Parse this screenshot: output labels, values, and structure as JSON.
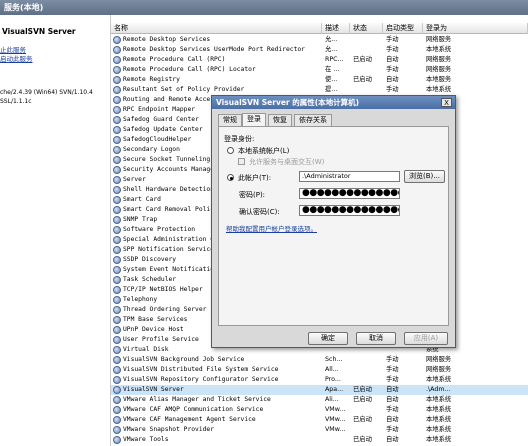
{
  "window": {
    "title": "服务(本地)"
  },
  "left_pane": {
    "service_title": "VisualSVN Server",
    "links": [
      "止此服务",
      "启动此服务"
    ],
    "desc_lines": [
      "che/2.4.39 (Win64) SVN/1.10.4",
      "SSL/1.1.1c"
    ]
  },
  "table": {
    "columns": [
      "名称",
      "描述",
      "状态",
      "启动类型",
      "登录为"
    ],
    "rows": [
      {
        "name": "Remote Desktop Services",
        "desc": "允...",
        "status": "",
        "startup": "手动",
        "logon": "网络服务"
      },
      {
        "name": "Remote Desktop Services UserMode Port Redirector",
        "desc": "允...",
        "status": "",
        "startup": "手动",
        "logon": "本地系统"
      },
      {
        "name": "Remote Procedure Call (RPC)",
        "desc": "RPC...",
        "status": "已启动",
        "startup": "自动",
        "logon": "网络服务"
      },
      {
        "name": "Remote Procedure Call (RPC) Locator",
        "desc": "在 ...",
        "status": "",
        "startup": "手动",
        "logon": "网络服务"
      },
      {
        "name": "Remote Registry",
        "desc": "使...",
        "status": "已启动",
        "startup": "自动",
        "logon": "本地服务"
      },
      {
        "name": "Resultant Set of Policy Provider",
        "desc": "提...",
        "status": "",
        "startup": "手动",
        "logon": "本地系统"
      },
      {
        "name": "Routing and Remote Access",
        "desc": "",
        "status": "",
        "startup": "",
        "logon": "系统"
      },
      {
        "name": "RPC Endpoint Mapper",
        "desc": "",
        "status": "",
        "startup": "",
        "logon": "服务"
      },
      {
        "name": "Safedog Guard Center",
        "desc": "",
        "status": "",
        "startup": "",
        "logon": "系统"
      },
      {
        "name": "Safedog Update Center",
        "desc": "",
        "status": "",
        "startup": "",
        "logon": "系统"
      },
      {
        "name": "SafedogCloudHelper",
        "desc": "",
        "status": "",
        "startup": "",
        "logon": "系统"
      },
      {
        "name": "Secondary Logon",
        "desc": "",
        "status": "",
        "startup": "",
        "logon": "系统"
      },
      {
        "name": "Secure Socket Tunneling P",
        "desc": "",
        "status": "",
        "startup": "",
        "logon": "服务"
      },
      {
        "name": "Security Accounts Manager",
        "desc": "",
        "status": "",
        "startup": "",
        "logon": "系统"
      },
      {
        "name": "Server",
        "desc": "",
        "status": "",
        "startup": "",
        "logon": "系统"
      },
      {
        "name": "Shell Hardware Detection",
        "desc": "",
        "status": "",
        "startup": "",
        "logon": "系统"
      },
      {
        "name": "Smart Card",
        "desc": "",
        "status": "",
        "startup": "",
        "logon": "服务"
      },
      {
        "name": "Smart Card Removal Polic",
        "desc": "",
        "status": "",
        "startup": "",
        "logon": "系统"
      },
      {
        "name": "SNMP Trap",
        "desc": "",
        "status": "",
        "startup": "",
        "logon": "服务"
      },
      {
        "name": "Software Protection",
        "desc": "",
        "status": "",
        "startup": "",
        "logon": "服务"
      },
      {
        "name": "Special Administration Co",
        "desc": "",
        "status": "",
        "startup": "",
        "logon": "系统"
      },
      {
        "name": "SPP Notification Service",
        "desc": "",
        "status": "",
        "startup": "",
        "logon": "服务"
      },
      {
        "name": "SSDP Discovery",
        "desc": "",
        "status": "",
        "startup": "",
        "logon": "服务"
      },
      {
        "name": "System Event Notificatio",
        "desc": "",
        "status": "",
        "startup": "",
        "logon": "系统"
      },
      {
        "name": "Task Scheduler",
        "desc": "",
        "status": "",
        "startup": "",
        "logon": "系统"
      },
      {
        "name": "TCP/IP NetBIOS Helper",
        "desc": "",
        "status": "",
        "startup": "",
        "logon": "服务"
      },
      {
        "name": "Telephony",
        "desc": "",
        "status": "",
        "startup": "",
        "logon": "服务"
      },
      {
        "name": "Thread Ordering Server",
        "desc": "",
        "status": "",
        "startup": "",
        "logon": "服务"
      },
      {
        "name": "TPM Base Services",
        "desc": "",
        "status": "",
        "startup": "",
        "logon": "服务"
      },
      {
        "name": "UPnP Device Host",
        "desc": "",
        "status": "",
        "startup": "",
        "logon": "服务"
      },
      {
        "name": "User Profile Service",
        "desc": "",
        "status": "",
        "startup": "",
        "logon": "系统"
      },
      {
        "name": "Virtual Disk",
        "desc": "",
        "status": "",
        "startup": "",
        "logon": "系统"
      },
      {
        "name": "VisualSVN Background Job Service",
        "desc": "Sch...",
        "status": "",
        "startup": "手动",
        "logon": "网络服务"
      },
      {
        "name": "VisualSVN Distributed File System Service",
        "desc": "All...",
        "status": "",
        "startup": "手动",
        "logon": "网络服务"
      },
      {
        "name": "VisualSVN Repository Configurator Service",
        "desc": "Pro...",
        "status": "",
        "startup": "手动",
        "logon": "本地系统"
      },
      {
        "name": "VisualSVN Server",
        "desc": "Apa...",
        "status": "已启动",
        "startup": "自动",
        "logon": ".\\Adm..."
      },
      {
        "name": "VMware Alias Manager and Ticket Service",
        "desc": "Ali...",
        "status": "已启动",
        "startup": "自动",
        "logon": "本地系统"
      },
      {
        "name": "VMware CAF AMQP Communication Service",
        "desc": "VMw...",
        "status": "",
        "startup": "手动",
        "logon": "本地系统"
      },
      {
        "name": "VMware CAF Management Agent Service",
        "desc": "VMw...",
        "status": "已启动",
        "startup": "自动",
        "logon": "本地系统"
      },
      {
        "name": "VMware Snapshot Provider",
        "desc": "VMw...",
        "status": "",
        "startup": "手动",
        "logon": "本地系统"
      },
      {
        "name": "VMware Tools",
        "desc": "",
        "status": "已启动",
        "startup": "自动",
        "logon": "本地系统"
      }
    ]
  },
  "dialog": {
    "title": "VisualSVN Server 的属性(本地计算机)",
    "close_label": "X",
    "tabs": [
      "常规",
      "登录",
      "恢复",
      "依存关系"
    ],
    "active_tab": "登录",
    "logon_as_label": "登录身份:",
    "local_system_label": "本地系统帐户(L)",
    "allow_desktop_label": "允许服务与桌面交互(W)",
    "this_account_label": "此帐户(T):",
    "account_value": ".\\Administrator",
    "browse_label": "浏览(B)...",
    "password_label": "密码(P):",
    "confirm_password_label": "确认密码(C):",
    "password_mask": "●●●●●●●●●●●●●●●",
    "help_link": "帮助我配置用户帐户登录选项。",
    "ok_label": "确定",
    "cancel_label": "取消",
    "apply_label": "应用(A)"
  },
  "colors": {
    "selection": "#cce4f7",
    "title_bar": "#4a6fa6",
    "link": "#1a3fa0"
  }
}
